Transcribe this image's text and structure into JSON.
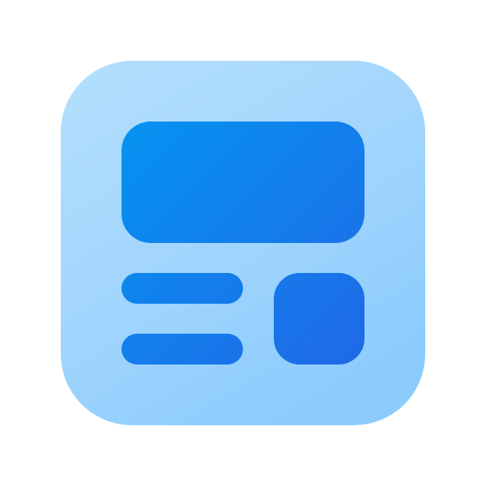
{
  "icon": {
    "name": "layout-dashboard-icon",
    "colors": {
      "tile_light": "#B3E0FD",
      "tile_mid": "#A4D6FD",
      "tile_dark": "#8CCCFD",
      "accent_start": "#0593F1",
      "accent_end": "#2069E6"
    }
  }
}
